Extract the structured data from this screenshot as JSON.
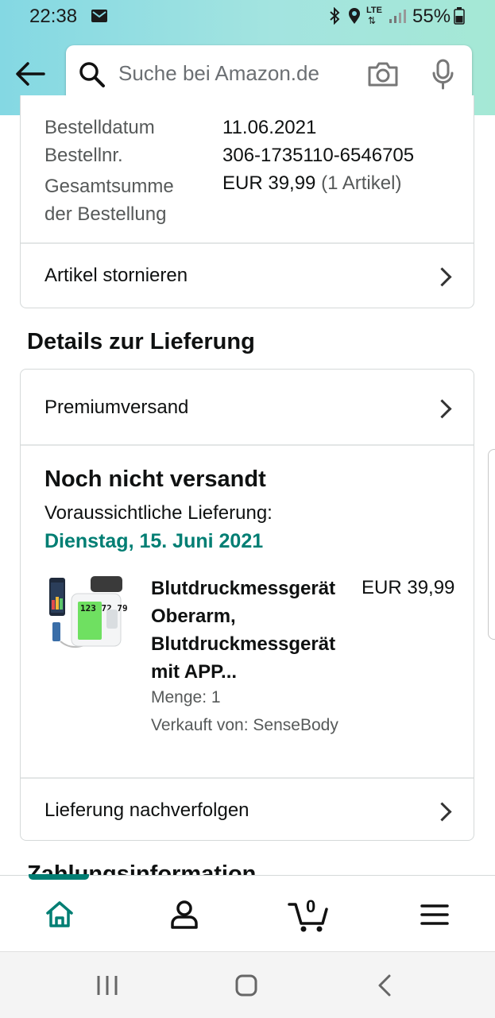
{
  "status_bar": {
    "time": "22:38",
    "network": "LTE",
    "battery": "55%"
  },
  "search": {
    "placeholder": "Suche bei Amazon.de"
  },
  "order_summary": {
    "rows": [
      {
        "label": "Bestelldatum",
        "value": "11.06.2021"
      },
      {
        "label": "Bestellnr.",
        "value": "306-1735110-6546705"
      },
      {
        "label": "Gesamtsumme der Bestellung",
        "value_amount": "EUR 39,99",
        "value_note": "(1 Artikel)"
      }
    ],
    "cancel_label": "Artikel stornieren"
  },
  "delivery": {
    "title": "Details zur Lieferung",
    "shipping_method": "Premiumversand",
    "status": "Noch nicht versandt",
    "expected_label": "Voraussichtliche Lieferung:",
    "expected_date": "Dienstag, 15. Juni 2021",
    "product": {
      "title_lines": [
        "Blutdruckmessgerät",
        "Oberarm,",
        "Blutdruckmessgerät",
        "mit APP..."
      ],
      "price": "EUR 39,99",
      "quantity": "Menge: 1",
      "seller": "Verkauft von: SenseBody",
      "image_text": "123 72 79"
    },
    "track_label": "Lieferung nachverfolgen"
  },
  "next_section_title": "Zahlungsinformation",
  "bottom_nav": {
    "cart_count": "0"
  },
  "colors": {
    "teal": "#007e73",
    "header_start": "#84d8e3",
    "header_end": "#a5e8d5"
  },
  "icons": [
    "mail-icon",
    "bluetooth-icon",
    "location-icon",
    "signal-icon",
    "battery-icon",
    "back-arrow-icon",
    "search-icon",
    "camera-icon",
    "mic-icon",
    "chevron-right-icon",
    "home-icon",
    "account-icon",
    "cart-icon",
    "menu-icon",
    "recent-apps-icon",
    "home-circle-icon",
    "system-back-icon"
  ]
}
